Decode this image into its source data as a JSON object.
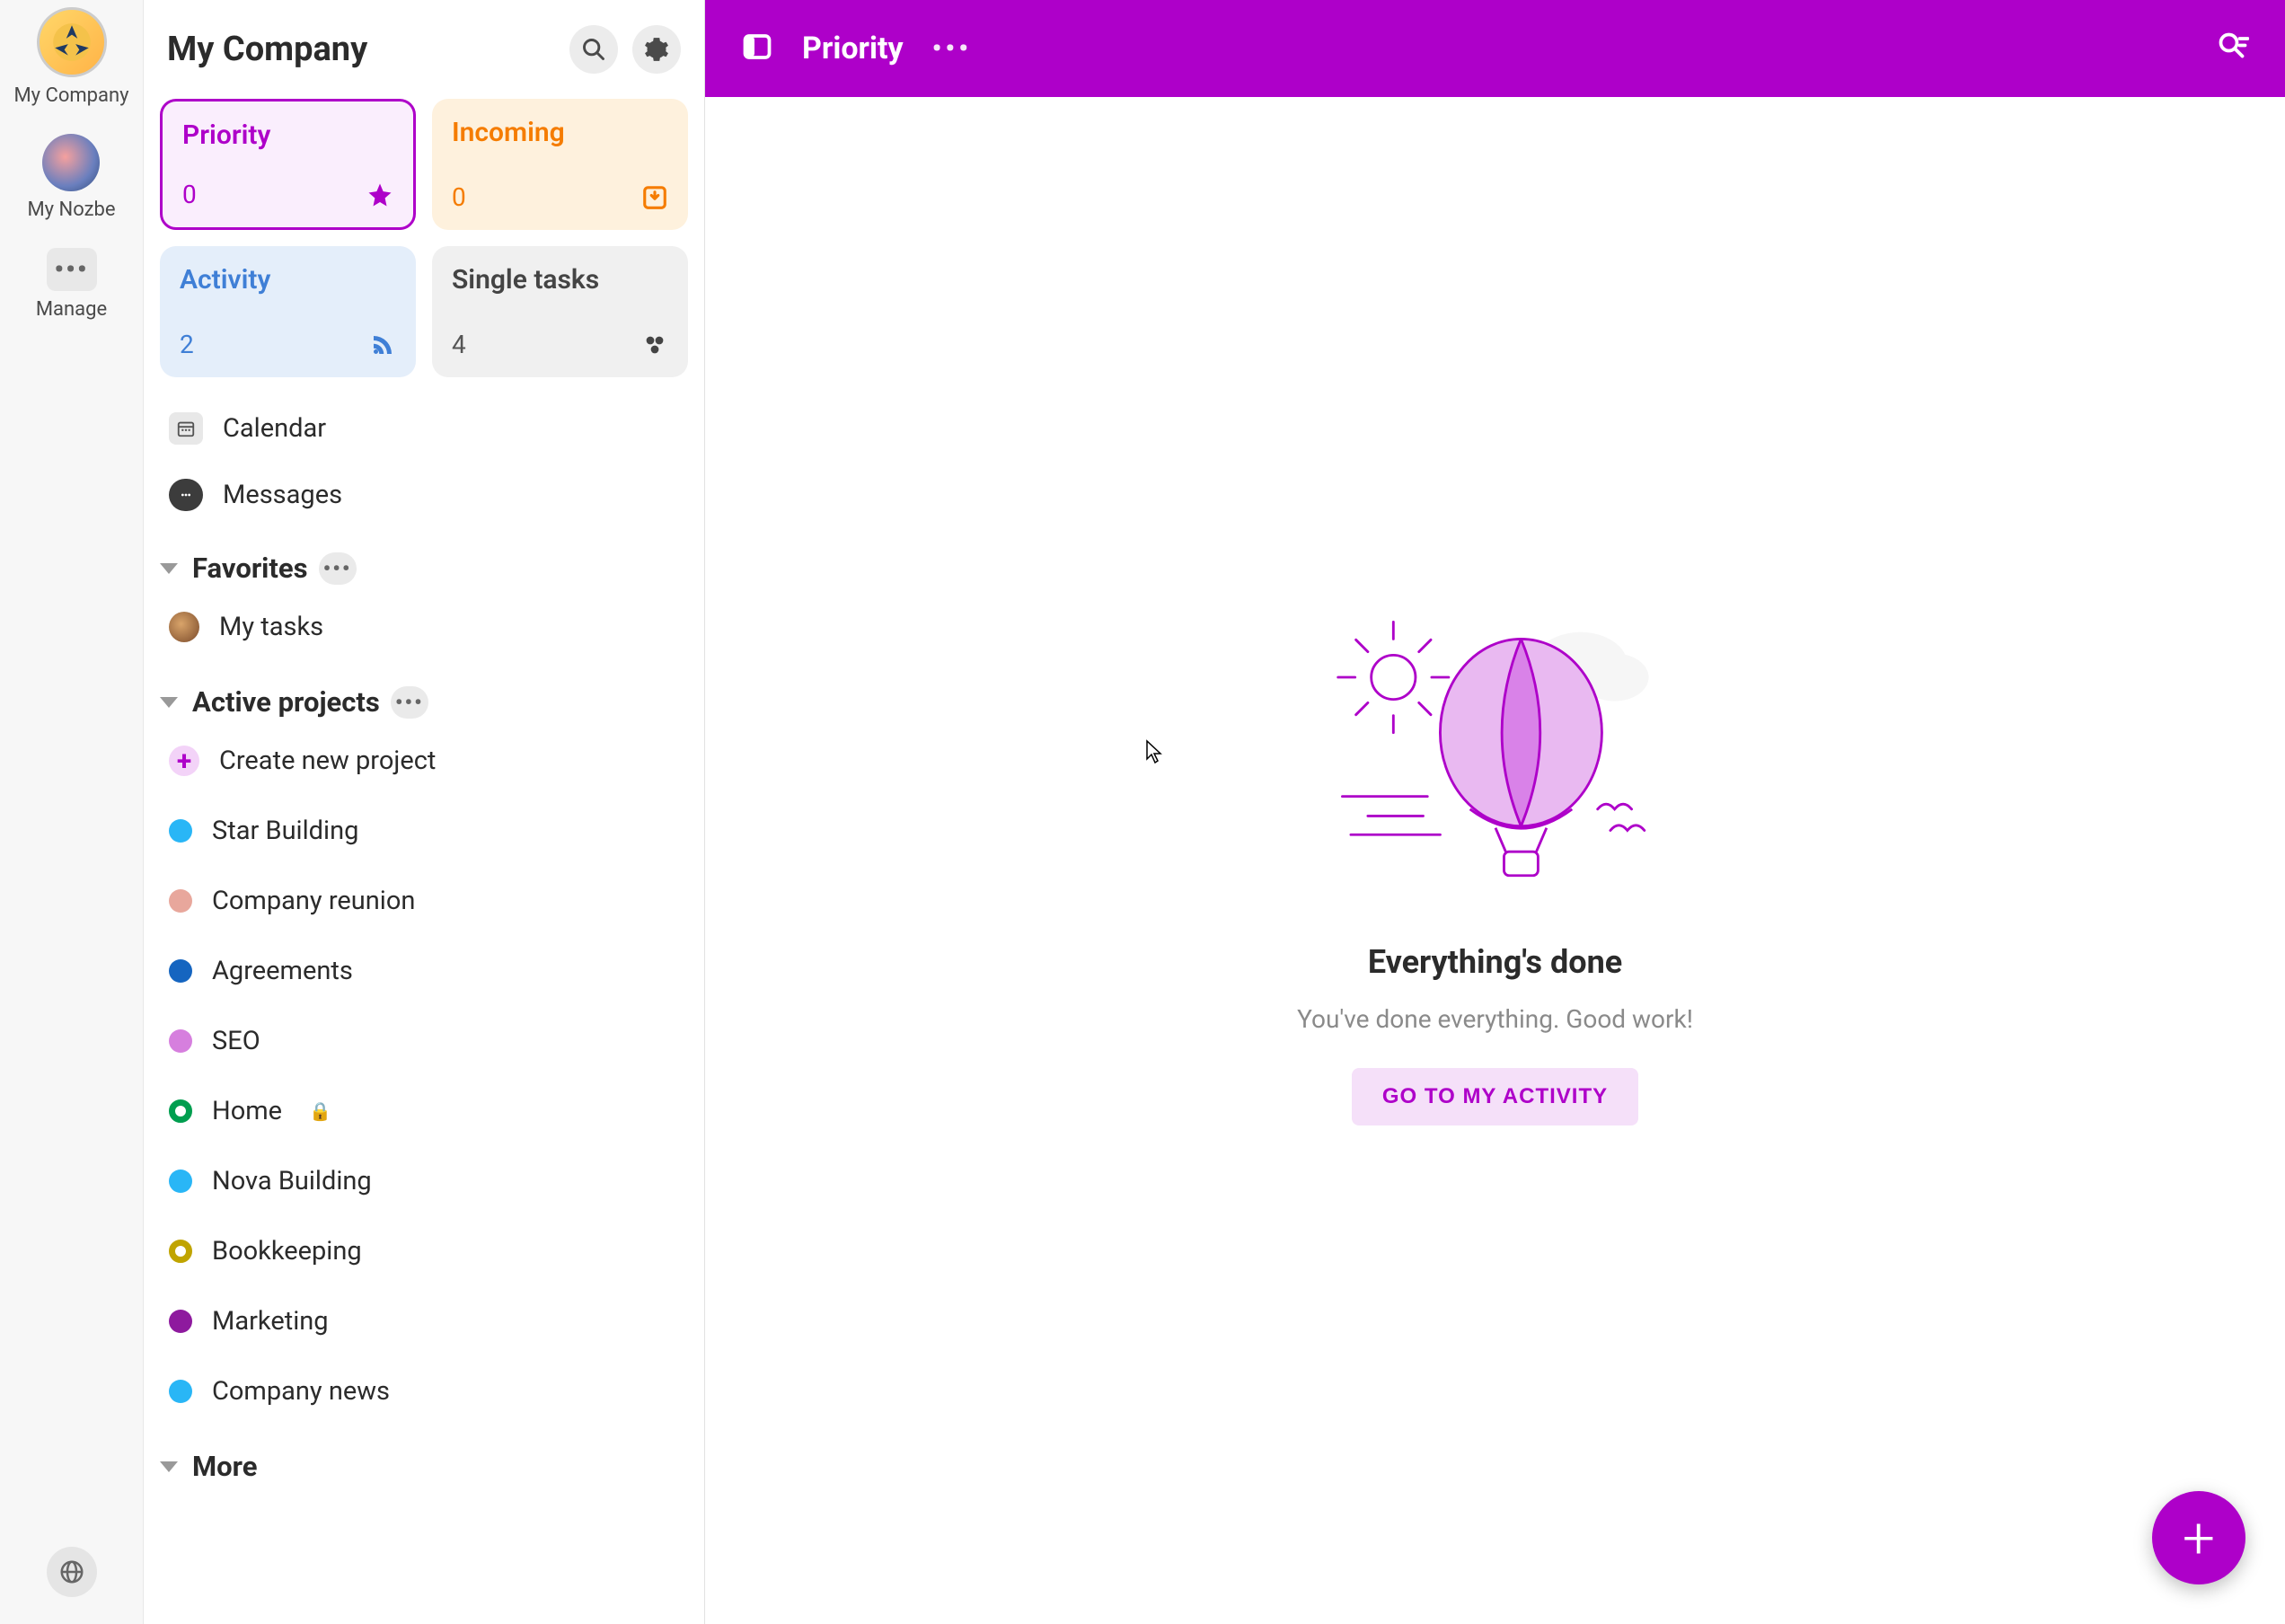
{
  "rail": {
    "company": "My Company",
    "nozbe": "My Nozbe",
    "manage": "Manage"
  },
  "panel": {
    "title": "My Company",
    "tiles": {
      "priority": {
        "label": "Priority",
        "count": "0"
      },
      "incoming": {
        "label": "Incoming",
        "count": "0"
      },
      "activity": {
        "label": "Activity",
        "count": "2"
      },
      "single": {
        "label": "Single tasks",
        "count": "4"
      }
    },
    "calendar": "Calendar",
    "messages": "Messages",
    "favorites_label": "Favorites",
    "my_tasks": "My tasks",
    "active_label": "Active projects",
    "create_project": "Create new project",
    "projects": [
      {
        "name": "Star Building",
        "color": "#29B6F6",
        "style": "solid"
      },
      {
        "name": "Company reunion",
        "color": "#E8A79C",
        "style": "solid"
      },
      {
        "name": "Agreements",
        "color": "#1565C0",
        "style": "solid"
      },
      {
        "name": "SEO",
        "color": "#D67FDE",
        "style": "solid"
      },
      {
        "name": "Home",
        "color": "#009E4F",
        "style": "ring",
        "locked": true
      },
      {
        "name": "Nova Building",
        "color": "#29B6F6",
        "style": "solid"
      },
      {
        "name": "Bookkeeping",
        "color": "#C0A400",
        "style": "ring"
      },
      {
        "name": "Marketing",
        "color": "#8E1A9E",
        "style": "solid"
      },
      {
        "name": "Company news",
        "color": "#29B6F6",
        "style": "solid"
      }
    ],
    "more_label": "More"
  },
  "topbar": {
    "title": "Priority"
  },
  "empty": {
    "title": "Everything's done",
    "subtitle": "You've done everything. Good work!",
    "button": "GO TO MY ACTIVITY"
  }
}
